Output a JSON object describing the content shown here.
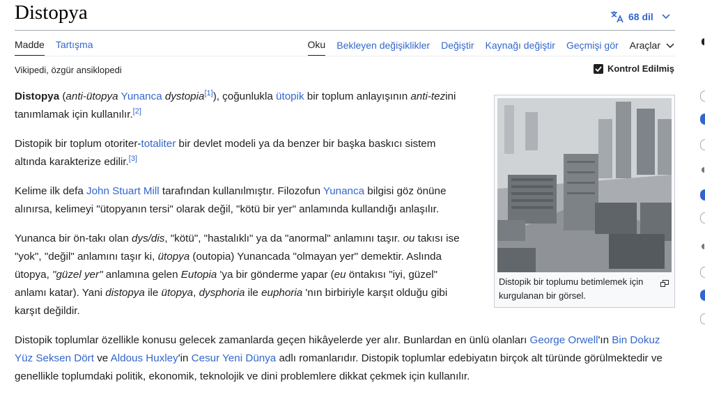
{
  "page": {
    "title": "Distopya",
    "languages_label": "68 dil"
  },
  "tabs": {
    "left": [
      {
        "label": "Madde",
        "active": true
      },
      {
        "label": "Tartışma",
        "active": false
      }
    ],
    "right": [
      {
        "label": "Oku",
        "active": true
      },
      {
        "label": "Bekleyen değişiklikler",
        "active": false
      },
      {
        "label": "Değiştir",
        "active": false
      },
      {
        "label": "Kaynağı değiştir",
        "active": false
      },
      {
        "label": "Geçmişi gör",
        "active": false
      }
    ],
    "tools_label": "Araçlar"
  },
  "tagline": "Vikipedi, özgür ansiklopedi",
  "review_status": "Kontrol Edilmiş",
  "infobox": {
    "caption": "Distopik bir toplumu betimlemek için kurgulanan bir görsel."
  },
  "article": {
    "p1": {
      "term": "Distopya",
      "t1": " (",
      "i1": "anti-ütopya",
      "l1": "Yunanca",
      "i2": " dystopia",
      "ref1": "[1]",
      "t2": "), çoğunluklа ",
      "l2": "ütopik",
      "t3": " bir toplum anlayışının ",
      "i3": "anti-tez",
      "t4": "ini tanımlamak için kullanılır.",
      "ref2": "[2]"
    },
    "p2": {
      "t1": "Distopik bir toplum otoriter-",
      "l1": "totaliter",
      "t2": " bir devlet modeli ya da benzer bir başka baskıcı sistem altında karakterize edilir.",
      "ref1": "[3]"
    },
    "p3": {
      "t1": "Kelime ilk defa ",
      "l1": "John Stuart Mill",
      "t2": " tarafından kullanılmıştır. Filozofun ",
      "l2": "Yunanca",
      "t3": " bilgisi göz önüne alınırsa, kelimeyi \"ütopyanın tersi\" olarak değil, \"kötü bir yer\" anlamında kullandığı anlaşılır."
    },
    "p4": {
      "t1": "Yunanca bir ön-takı olan ",
      "i1": "dys/dis",
      "t2": ", \"kötü\", \"hastalıklı\" ya da \"anormal\" anlamını taşır. ",
      "i2": "ou",
      "t3": " takısı ise \"yok\", \"değil\" anlamını taşır ki, ",
      "i3": "ütopya",
      "t4": " (outopia) Yunancada \"olmayan yer\" demektir. Aslında ütopya, ",
      "i4": "\"güzel yer\"",
      "t5": " anlamına gelen ",
      "i5": "Eutopia",
      "t6": " 'ya bir gönderme yapar (",
      "i6": "eu",
      "t7": " öntakısı \"iyi, güzel\" anlamı katar). Yani ",
      "i7": "distopya",
      "t8": " ile ",
      "i8": "ütopya",
      "t9": ", ",
      "i9": "dysphoria",
      "t10": " ile ",
      "i10": "euphoria",
      "t11": " 'nın birbiriyle karşıt olduğu gibi karşıt değildir."
    },
    "p5": {
      "t1": "Distopik toplumlar özellikle konusu gelecek zamanlarda geçen hikâyelerde yer alır. Bunlardan en ünlü olanları ",
      "l1": "George Orwell",
      "t2": "'ın ",
      "l2": "Bin Dokuz Yüz Seksen Dört",
      "t3": " ve ",
      "l3": "Aldous Huxley",
      "t4": "'in ",
      "l4": "Cesur Yeni Dünya",
      "t5": " adlı romanlarıdır. Distopik toplumlar edebiyatın birçok alt türünde görülmektedir ve genellikle toplumdaki politik, ekonomik, teknolojik ve dini problemlere dikkat çekmek için kullanılır."
    }
  },
  "icons": {
    "language": "translate-icon",
    "chevron": "chevron-down-icon",
    "check": "checkbox-checked-icon",
    "enlarge": "enlarge-icon"
  },
  "colors": {
    "link": "#3366cc",
    "text": "#202122",
    "rule": "#a2a9b1"
  }
}
